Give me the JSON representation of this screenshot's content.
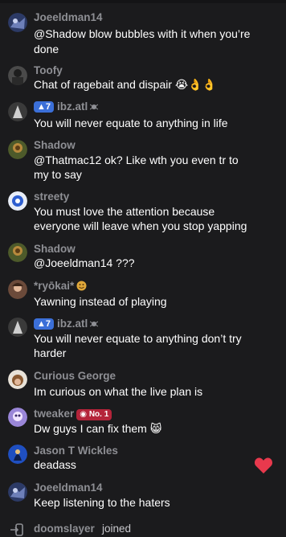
{
  "messages": [
    {
      "user": "Joeeldman14",
      "lines": [
        "@Shadow blow bubbles with it when you’re",
        "done"
      ]
    },
    {
      "user": "Toofy",
      "lines": [
        "Chat of ragebait and dispair 😭👌👌"
      ]
    },
    {
      "user": "ibz.atl",
      "level": "7",
      "lines": [
        "You will never equate to anything in life"
      ]
    },
    {
      "user": "Shadow",
      "lines": [
        "@Thatmac12 ok? Like wth you even tr to",
        "my to say"
      ]
    },
    {
      "user": "streety",
      "lines": [
        "You must love the attention because",
        "everyone will leave when you stop yapping"
      ]
    },
    {
      "user": "Shadow",
      "lines": [
        "@Joeeldman14 ???"
      ]
    },
    {
      "user": "*ryōkai*",
      "lines": [
        "Yawning instead of playing"
      ]
    },
    {
      "user": "ibz.atl",
      "level": "7",
      "lines": [
        "You will never equate to anything don’t try",
        "harder"
      ]
    },
    {
      "user": "Curious George",
      "lines": [
        "Im curious on what the live plan is"
      ]
    },
    {
      "user": "tweaker",
      "rank_badge": "No. 1",
      "lines": [
        "Dw guys I can fix them 😸"
      ]
    },
    {
      "user": "Jason T Wickles",
      "lines": [
        "deadass"
      ]
    },
    {
      "user": "Joeeldman14",
      "lines": [
        "Keep listening to the haters"
      ]
    }
  ],
  "join_event": {
    "user": "doomslayer",
    "text": "joined"
  },
  "colors": {
    "background": "#1b1b1d",
    "username": "#8e8f94",
    "message_text": "#ffffff",
    "level_badge": "#3b6fd8",
    "rank_badge": "#b4243a",
    "heart": "#e8394d"
  },
  "icons": {
    "level_badge": "level-badge-icon",
    "rank_badge": "rank-badge-icon",
    "heart": "heart-reaction-icon",
    "join": "join-arrow-icon"
  }
}
